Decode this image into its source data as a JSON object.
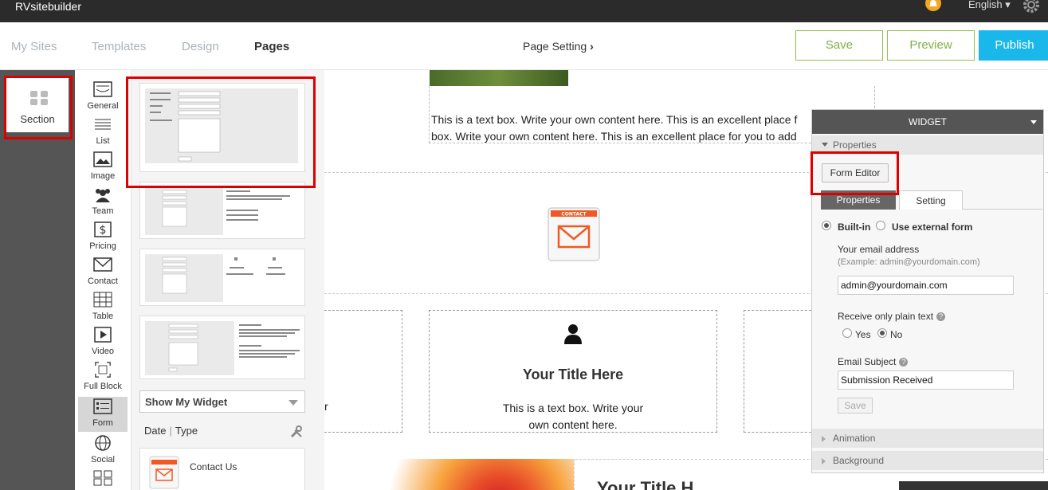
{
  "app": {
    "brand": "RVsitebuilder",
    "language": "English"
  },
  "nav": {
    "tabs": [
      "My Sites",
      "Templates",
      "Design",
      "Pages"
    ],
    "page_setting": "Page Setting",
    "save": "Save",
    "preview": "Preview",
    "publish": "Publish"
  },
  "section": {
    "label": "Section"
  },
  "categories": [
    "General",
    "List",
    "Image",
    "Team",
    "Pricing",
    "Contact",
    "Table",
    "Video",
    "Full Block",
    "Form",
    "Social"
  ],
  "active_category": "Form",
  "widget_list": {
    "show_label": "Show My Widget",
    "filter_date": "Date",
    "filter_type": "Type",
    "my_widget": "Contact Us"
  },
  "canvas": {
    "textbox_line1": "This is a text box. Write your own content here. This is an excellent place f",
    "textbox_line2": "box. Write your own content here. This is an excellent place for you to add",
    "contact_icon_label": "CONTACT",
    "col_left_text": "r",
    "col_mid_title": "Your Title Here",
    "col_mid_text_1": "This is a text box. Write your",
    "col_mid_text_2": "own content here.",
    "bottom_title": "Your Title H"
  },
  "widget_panel": {
    "header": "WIDGET",
    "properties_section": "Properties",
    "form_editor": "Form Editor",
    "tab_properties": "Properties",
    "tab_setting": "Setting",
    "builtin": "Built-in",
    "external": "Use external form",
    "email_label": "Your email address",
    "email_hint": "(Example: admin@yourdomain.com)",
    "email_value": "admin@yourdomain.com",
    "plain_text_label": "Receive only plain text",
    "yes": "Yes",
    "no": "No",
    "subject_label": "Email Subject",
    "subject_value": "Submission Received",
    "save": "Save",
    "animation": "Animation",
    "background": "Background"
  }
}
